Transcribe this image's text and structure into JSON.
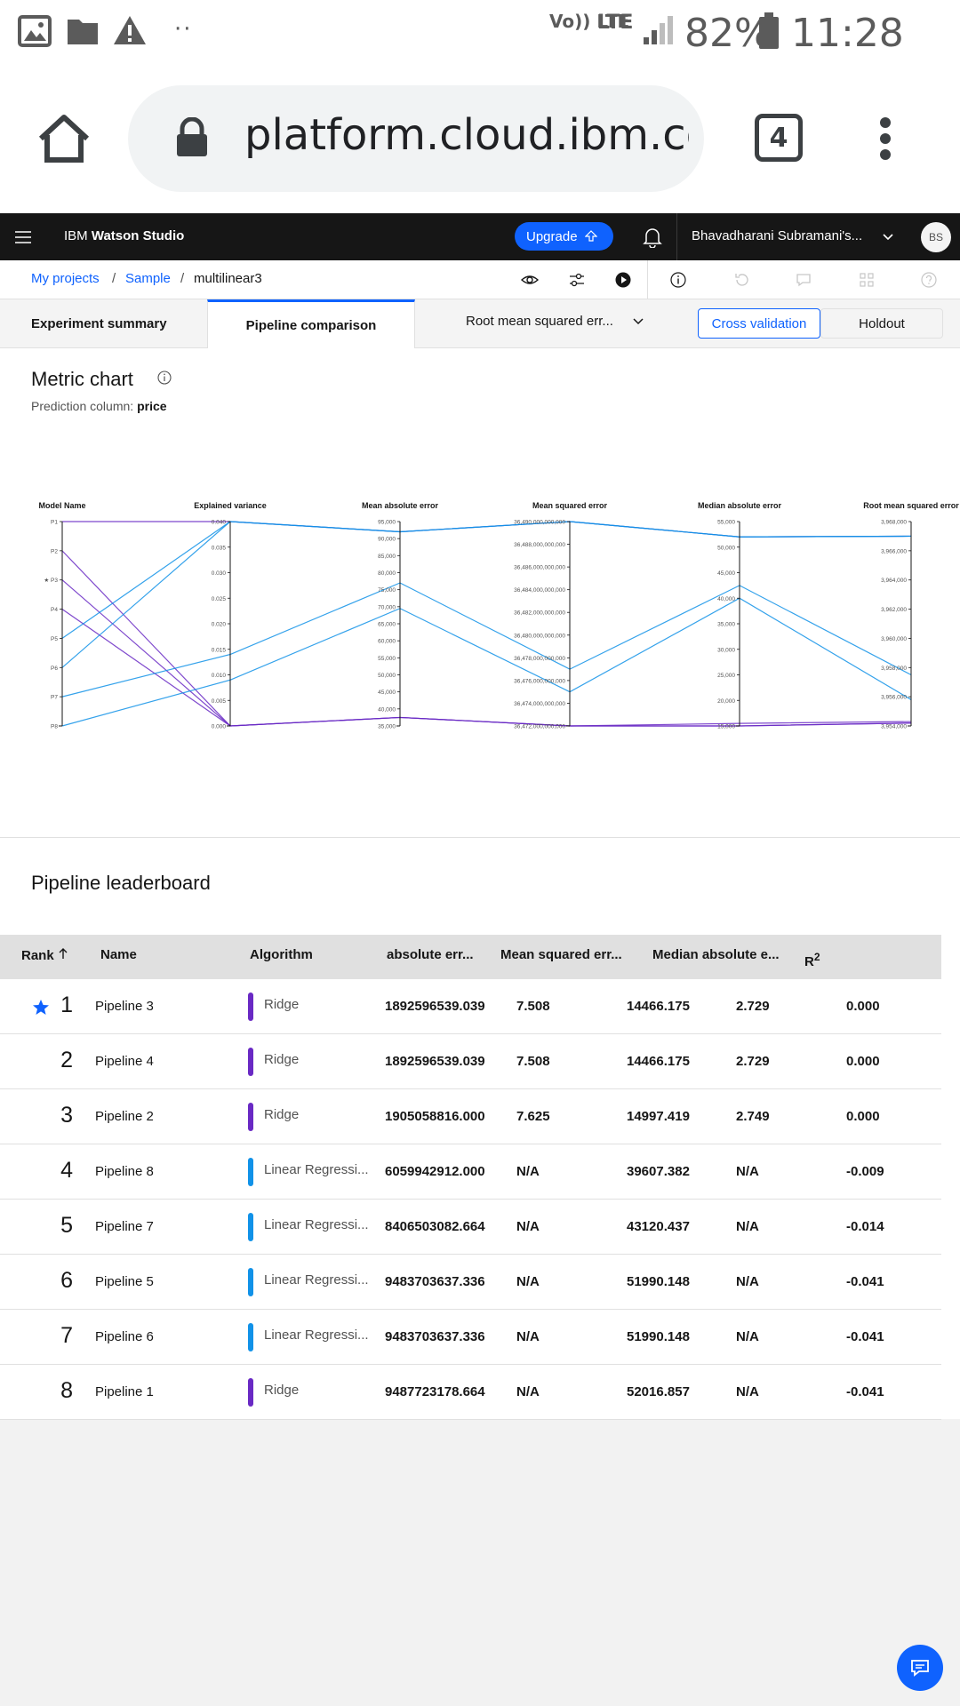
{
  "status_bar": {
    "network": "Vo)) LTE",
    "lte": "LTE",
    "battery": "82%",
    "time": "11:28 am"
  },
  "browser": {
    "url": "platform.cloud.ibm.com",
    "tab_count": "4"
  },
  "top_nav": {
    "brand_prefix": "IBM",
    "brand_name": "Watson Studio",
    "upgrade_label": "Upgrade",
    "account": "Bhavadharani Subramani's...",
    "avatar": "BS"
  },
  "breadcrumb": {
    "projects": "My projects",
    "project": "Sample",
    "current": "multilinear3"
  },
  "tabs": {
    "summary": "Experiment summary",
    "comparison": "Pipeline comparison",
    "metric_select": "Root mean squared err...",
    "cross_validation": "Cross validation",
    "holdout": "Holdout"
  },
  "metric_chart": {
    "title": "Metric chart",
    "prediction_label": "Prediction column:",
    "prediction_value": "price"
  },
  "chart_data": {
    "type": "parallel-coordinates",
    "axes": [
      {
        "name": "Model Name",
        "ticks": [
          "P1",
          "P2",
          "P3",
          "P4",
          "P5",
          "P6",
          "P7",
          "P8"
        ]
      },
      {
        "name": "Explained variance",
        "range": [
          0,
          0.04
        ],
        "ticks": [
          "0.040",
          "0.035",
          "0.030",
          "0.025",
          "0.020",
          "0.015",
          "0.010",
          "0.005",
          "0.000"
        ]
      },
      {
        "name": "Mean absolute error",
        "range": [
          35000,
          95000
        ],
        "ticks": [
          "95,000",
          "90,000",
          "85,000",
          "80,000",
          "75,000",
          "70,000",
          "65,000",
          "60,000",
          "55,000",
          "50,000",
          "45,000",
          "40,000",
          "35,000"
        ]
      },
      {
        "name": "Mean squared error",
        "range": [
          36472000000000,
          36490000000000
        ],
        "ticks": [
          "36,490,000,000,000",
          "36,488,000,000,000",
          "36,486,000,000,000",
          "36,484,000,000,000",
          "36,482,000,000,000",
          "36,480,000,000,000",
          "36,478,000,000,000",
          "36,476,000,000,000",
          "36,474,000,000,000",
          "36,472,000,000,000"
        ]
      },
      {
        "name": "Median absolute error",
        "range": [
          15000,
          55000
        ],
        "ticks": [
          "55,000",
          "50,000",
          "45,000",
          "40,000",
          "35,000",
          "30,000",
          "25,000",
          "20,000",
          "15,000"
        ]
      },
      {
        "name": "Root mean squared error",
        "range": [
          3954000,
          3968000
        ],
        "ticks": [
          "3,968,000",
          "3,966,000",
          "3,964,000",
          "3,962,000",
          "3,960,000",
          "3,958,000",
          "3,956,000",
          "3,954,000"
        ]
      }
    ],
    "series": [
      {
        "name": "P1",
        "color": "#6929c4",
        "values": [
          0.04,
          92000,
          36490000000000,
          52000,
          3967000
        ]
      },
      {
        "name": "P2",
        "color": "#6929c4",
        "values": [
          0.0,
          37500,
          36472000000000,
          15500,
          3954300
        ]
      },
      {
        "name": "P3",
        "color": "#6929c4",
        "values": [
          0.0,
          37500,
          36472000000000,
          15000,
          3954200
        ]
      },
      {
        "name": "P4",
        "color": "#6929c4",
        "values": [
          0.0,
          37500,
          36472000000000,
          15000,
          3954200
        ]
      },
      {
        "name": "P5",
        "color": "#1192e8",
        "values": [
          0.04,
          92000,
          36490000000000,
          52000,
          3967000
        ]
      },
      {
        "name": "P6",
        "color": "#1192e8",
        "values": [
          0.04,
          92000,
          36490000000000,
          52000,
          3967000
        ]
      },
      {
        "name": "P7",
        "color": "#1192e8",
        "values": [
          0.014,
          77000,
          36477000000000,
          42500,
          3957500
        ]
      },
      {
        "name": "P8",
        "color": "#1192e8",
        "values": [
          0.009,
          69500,
          36475000000000,
          40000,
          3955800
        ]
      }
    ]
  },
  "leaderboard": {
    "title": "Pipeline leaderboard",
    "headers": [
      "Rank",
      "Name",
      "Algorithm",
      "absolute err...",
      "Mean squared err...",
      "Median absolute e...",
      "R",
      "2"
    ],
    "rows": [
      {
        "rank": "1",
        "starred": true,
        "name": "Pipeline 3",
        "algorithm": "Ridge",
        "color": "#6929c4",
        "v1": "1892596539.039",
        "v2": "7.508",
        "v3": "14466.175",
        "v4": "2.729",
        "v5": "0.000"
      },
      {
        "rank": "2",
        "starred": false,
        "name": "Pipeline 4",
        "algorithm": "Ridge",
        "color": "#6929c4",
        "v1": "1892596539.039",
        "v2": "7.508",
        "v3": "14466.175",
        "v4": "2.729",
        "v5": "0.000"
      },
      {
        "rank": "3",
        "starred": false,
        "name": "Pipeline 2",
        "algorithm": "Ridge",
        "color": "#6929c4",
        "v1": "1905058816.000",
        "v2": "7.625",
        "v3": "14997.419",
        "v4": "2.749",
        "v5": "0.000"
      },
      {
        "rank": "4",
        "starred": false,
        "name": "Pipeline 8",
        "algorithm": "Linear Regressi...",
        "color": "#1192e8",
        "v1": "6059942912.000",
        "v2": "N/A",
        "v3": "39607.382",
        "v4": "N/A",
        "v5": "-0.009"
      },
      {
        "rank": "5",
        "starred": false,
        "name": "Pipeline 7",
        "algorithm": "Linear Regressi...",
        "color": "#1192e8",
        "v1": "8406503082.664",
        "v2": "N/A",
        "v3": "43120.437",
        "v4": "N/A",
        "v5": "-0.014"
      },
      {
        "rank": "6",
        "starred": false,
        "name": "Pipeline 5",
        "algorithm": "Linear Regressi...",
        "color": "#1192e8",
        "v1": "9483703637.336",
        "v2": "N/A",
        "v3": "51990.148",
        "v4": "N/A",
        "v5": "-0.041"
      },
      {
        "rank": "7",
        "starred": false,
        "name": "Pipeline 6",
        "algorithm": "Linear Regressi...",
        "color": "#1192e8",
        "v1": "9483703637.336",
        "v2": "N/A",
        "v3": "51990.148",
        "v4": "N/A",
        "v5": "-0.041"
      },
      {
        "rank": "8",
        "starred": false,
        "name": "Pipeline 1",
        "algorithm": "Ridge",
        "color": "#6929c4",
        "v1": "9487723178.664",
        "v2": "N/A",
        "v3": "52016.857",
        "v4": "N/A",
        "v5": "-0.041"
      }
    ]
  },
  "colors": {
    "accent": "#0f62fe",
    "ridge": "#6929c4",
    "linear": "#1192e8",
    "nav_bg": "#161616"
  }
}
